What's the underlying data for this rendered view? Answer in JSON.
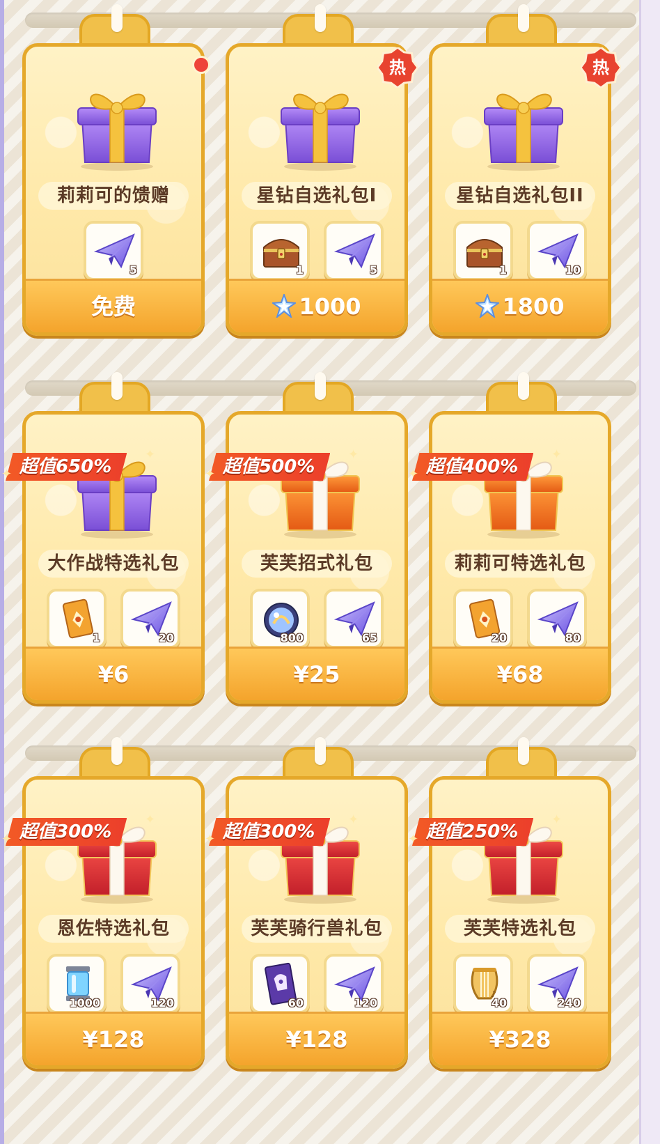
{
  "badges": {
    "hot_label": "热"
  },
  "rows": [
    {
      "cards": [
        {
          "name": "莉莉可的馈赠",
          "gift": "purple",
          "badge": "dot",
          "tag": "",
          "items": [
            {
              "icon": "paper-plane-icon",
              "qty": "5"
            }
          ],
          "price": "免费",
          "currency": ""
        },
        {
          "name": "星钻自选礼包I",
          "gift": "purple",
          "badge": "hot",
          "tag": "",
          "items": [
            {
              "icon": "treasure-chest-icon",
              "qty": "1"
            },
            {
              "icon": "paper-plane-icon",
              "qty": "5"
            }
          ],
          "price": "1000",
          "currency": "star-diamond-icon"
        },
        {
          "name": "星钻自选礼包II",
          "gift": "purple",
          "badge": "hot",
          "tag": "",
          "items": [
            {
              "icon": "treasure-chest-icon",
              "qty": "1"
            },
            {
              "icon": "paper-plane-icon",
              "qty": "10"
            }
          ],
          "price": "1800",
          "currency": "star-diamond-icon"
        }
      ]
    },
    {
      "cards": [
        {
          "name": "大作战特选礼包",
          "gift": "purple",
          "badge": "",
          "tag": "超值650%",
          "items": [
            {
              "icon": "card-ticket-icon",
              "qty": "1"
            },
            {
              "icon": "paper-plane-icon",
              "qty": "20"
            }
          ],
          "price": "¥6",
          "currency": ""
        },
        {
          "name": "芙芙招式礼包",
          "gift": "orange",
          "badge": "",
          "tag": "超值500%",
          "items": [
            {
              "icon": "crystal-orb-icon",
              "qty": "800"
            },
            {
              "icon": "paper-plane-icon",
              "qty": "65"
            }
          ],
          "price": "¥25",
          "currency": ""
        },
        {
          "name": "莉莉可特选礼包",
          "gift": "orange",
          "badge": "",
          "tag": "超值400%",
          "items": [
            {
              "icon": "card-ticket-icon",
              "qty": "20"
            },
            {
              "icon": "paper-plane-icon",
              "qty": "80"
            }
          ],
          "price": "¥68",
          "currency": ""
        }
      ]
    },
    {
      "cards": [
        {
          "name": "恩佐特选礼包",
          "gift": "red",
          "badge": "",
          "tag": "超值300%",
          "items": [
            {
              "icon": "energy-canister-icon",
              "qty": "1000"
            },
            {
              "icon": "paper-plane-icon",
              "qty": "120"
            }
          ],
          "price": "¥128",
          "currency": ""
        },
        {
          "name": "芙芙骑行兽礼包",
          "gift": "red",
          "badge": "",
          "tag": "超值300%",
          "items": [
            {
              "icon": "mount-ticket-icon",
              "qty": "60"
            },
            {
              "icon": "paper-plane-icon",
              "qty": "120"
            }
          ],
          "price": "¥128",
          "currency": ""
        },
        {
          "name": "芙芙特选礼包",
          "gift": "red",
          "badge": "",
          "tag": "超值250%",
          "items": [
            {
              "icon": "lyre-harp-icon",
              "qty": "40"
            },
            {
              "icon": "paper-plane-icon",
              "qty": "240"
            }
          ],
          "price": "¥328",
          "currency": ""
        }
      ]
    }
  ],
  "colors": {
    "card_border": "#e5a82a",
    "price_bar": "#f4a42c",
    "value_tag": "#ec3f2b",
    "hot_badge": "#e8432f"
  }
}
